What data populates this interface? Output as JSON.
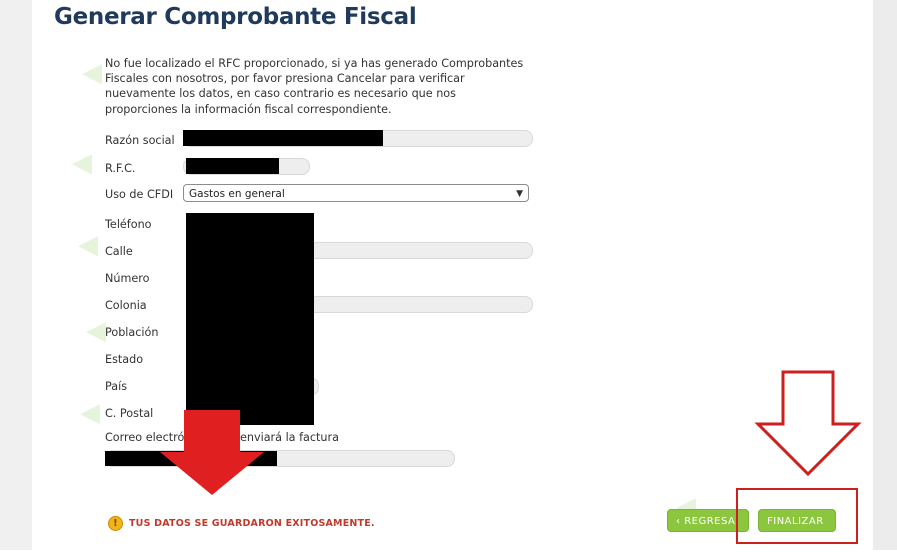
{
  "page": {
    "title": "Generar Comprobante Fiscal",
    "message": "No fue localizado el RFC proporcionado, si ya has generado Comprobantes Fiscales con nosotros, por favor presiona Cancelar para verificar nuevamente los datos, en caso contrario es necesario que nos proporciones la información fiscal correspondiente."
  },
  "form": {
    "razon_social_label": "Razón social",
    "rfc_label": "R.F.C.",
    "uso_cfdi_label": "Uso de CFDI",
    "uso_cfdi_value": "Gastos en general",
    "telefono_label": "Teléfono",
    "calle_label": "Calle",
    "numero_label": "Número",
    "colonia_label": "Colonia",
    "poblacion_label": "Población",
    "estado_label": "Estado",
    "pais_label": "País",
    "cpostal_label": "C. Postal",
    "correo_label_start": "Correo electrónic",
    "correo_label_end": "enviará la factura"
  },
  "status": {
    "message": "TUS DATOS SE GUARDARON EXITOSAMENTE.",
    "icon": "warning-icon",
    "color": "#c0392b"
  },
  "buttons": {
    "back_label": "REGRESA",
    "finish_label": "FINALIZAR",
    "back_glyph": "‹",
    "finish_glyph": "›"
  },
  "colors": {
    "title": "#1f3a5b",
    "button": "#8cc63f",
    "annotation": "#cc1f1f"
  }
}
